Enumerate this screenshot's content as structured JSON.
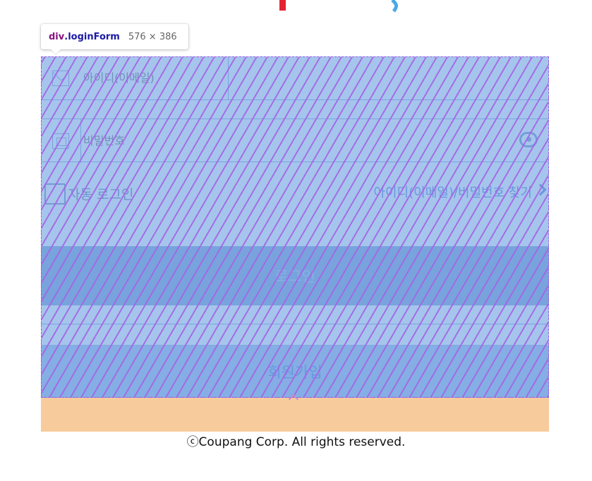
{
  "devtools_tooltip": {
    "tag": "div",
    "class_name": ".loginForm",
    "size": "576 × 386"
  },
  "login_form": {
    "id_field": {
      "placeholder": "아이디(이메일)",
      "icon": "mail-icon"
    },
    "password_field": {
      "placeholder": "비밀번호",
      "icon": "lock-icon",
      "toggle_icon": "eye-icon"
    },
    "auto_login_label": "자동 로그인",
    "find_account_link": "아이디(이메일)/비밀번호 찾기",
    "login_button": "로그인",
    "signup_button": "회원가입"
  },
  "footer": {
    "copyright": "ⓒCoupang Corp. All rights reserved."
  },
  "colors": {
    "highlight": "#6fa1e0",
    "hatch": "#a464e6",
    "margin_box": "#f8cb9c",
    "link": "#5f86d7"
  }
}
